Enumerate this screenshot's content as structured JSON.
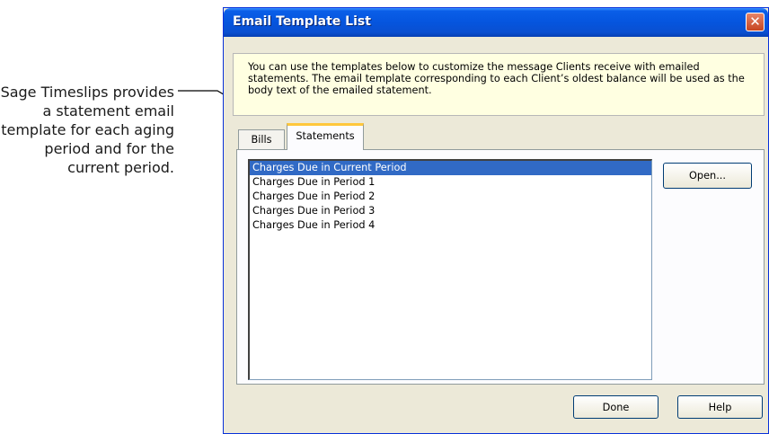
{
  "callout": {
    "text": "Sage Timeslips provides a statement email template for each aging period and for the current period."
  },
  "window": {
    "title": "Email Template List",
    "close_glyph": "✕",
    "info_text": "You can use the templates below to customize the message Clients receive with emailed statements. The email template corresponding to each Client’s oldest balance will be used as the body text of the emailed statement.",
    "tabs": [
      {
        "label": "Bills",
        "active": false
      },
      {
        "label": "Statements",
        "active": true
      }
    ],
    "templates": [
      {
        "label": "Charges Due in Current Period",
        "selected": true
      },
      {
        "label": "Charges Due in Period 1",
        "selected": false
      },
      {
        "label": "Charges Due in Period 2",
        "selected": false
      },
      {
        "label": "Charges Due in Period 3",
        "selected": false
      },
      {
        "label": "Charges Due in Period 4",
        "selected": false
      }
    ],
    "open_button": "Open...",
    "done_button": "Done",
    "help_button": "Help"
  },
  "colors": {
    "titlebar": "#0555de",
    "selection": "#316ac5",
    "info_bg": "#ffffe1",
    "active_tab_accent": "#ffc73c"
  }
}
